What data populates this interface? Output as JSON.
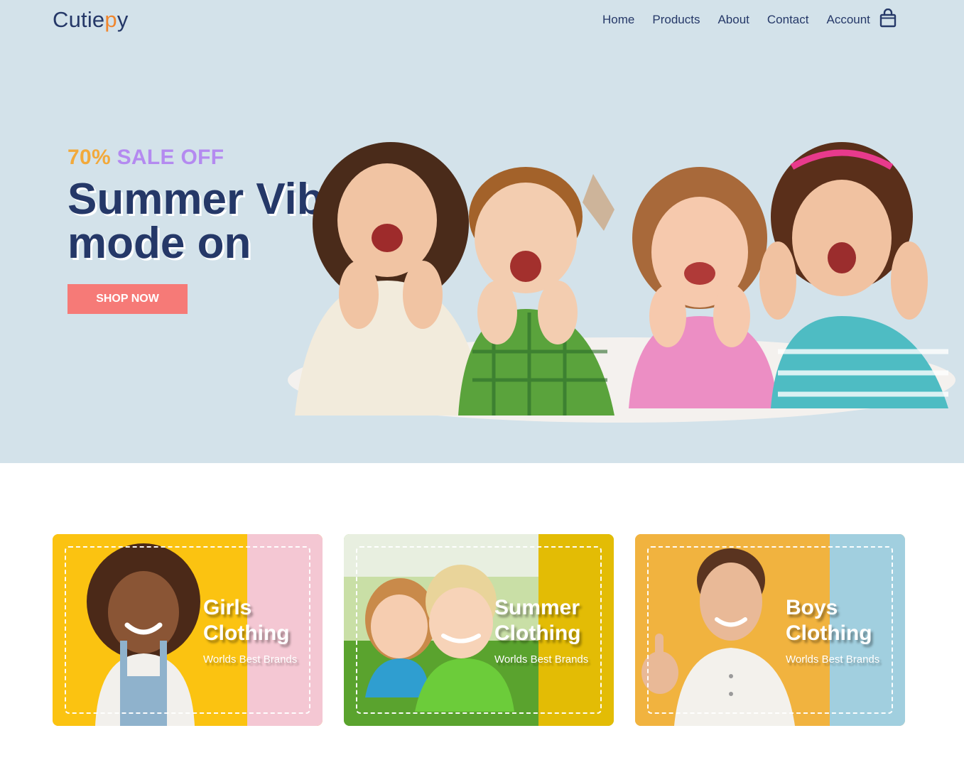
{
  "brand": {
    "name_main": "Cutie",
    "name_accent": "p",
    "name_end": "y"
  },
  "nav": {
    "items": [
      {
        "label": "Home"
      },
      {
        "label": "Products"
      },
      {
        "label": "About"
      },
      {
        "label": "Contact"
      },
      {
        "label": "Account"
      }
    ],
    "cart_icon": "shopping-bag-icon"
  },
  "hero": {
    "sale_percent": "70%",
    "sale_text": "SALE OFF",
    "headline_line1": "Summer Vibes",
    "headline_line2": "mode on",
    "cta_label": "SHOP NOW"
  },
  "categories": [
    {
      "title_line1": "Girls",
      "title_line2": "Clothing",
      "subtitle": "Worlds Best Brands",
      "color_main": "#fcc80f",
      "color_side": "#f4c7d3"
    },
    {
      "title_line1": "Summer",
      "title_line2": "Clothing",
      "subtitle": "Worlds Best Brands",
      "color_main": "#8fcd5a",
      "color_side": "#e3bc05"
    },
    {
      "title_line1": "Boys",
      "title_line2": "Clothing",
      "subtitle": "Worlds Best Brands",
      "color_main": "#f1b23f",
      "color_side": "#a1cfdf"
    }
  ],
  "colors": {
    "hero_bg": "#d3e2ea",
    "navy": "#253868",
    "logo_accent": "#f0862e",
    "sale_percent": "#f2a93b",
    "sale_text": "#b48af0",
    "cta_bg": "#f67a77"
  }
}
